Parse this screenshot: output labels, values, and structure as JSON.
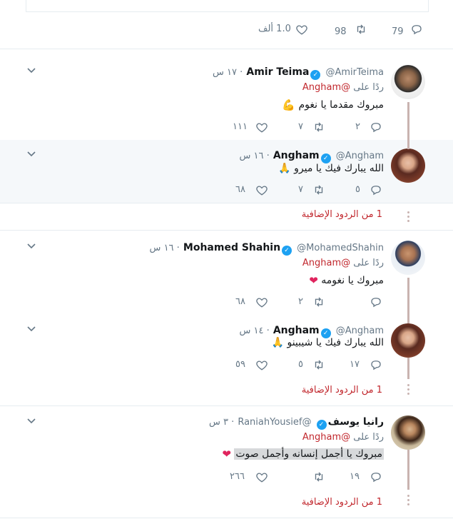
{
  "top_stats": {
    "replies": "79",
    "retweets": "98",
    "likes": "1.0 ألف"
  },
  "tweets": [
    {
      "name": "Amir Teima",
      "handle": "@AmirTeima",
      "time": "١٧ س",
      "reply_prefix": "ردًا على",
      "reply_to": "@Angham",
      "text": "مبروك مقدما يا نغوم",
      "replies": "٢",
      "retweets": "٧",
      "likes": "١١١"
    },
    {
      "name": "Angham",
      "handle": "@Angham",
      "time": "١٦ س",
      "text": "الله يبارك فيك يا ميرو",
      "replies": "٥",
      "retweets": "٧",
      "likes": "٦٨",
      "more": "1 من الردود الإضافية"
    },
    {
      "name": "Mohamed Shahin",
      "handle": "@MohamedShahin",
      "time": "١٦ س",
      "reply_prefix": "ردًا على",
      "reply_to": "@Angham",
      "text": "مبروك يا نغومه",
      "replies": "",
      "retweets": "٢",
      "likes": "٦٨"
    },
    {
      "name": "Angham",
      "handle": "@Angham",
      "time": "١٤ س",
      "text": "الله يبارك فيك يا شيبينو",
      "replies": "١٧",
      "retweets": "٥",
      "likes": "٥٩",
      "more": "1 من الردود الإضافية"
    },
    {
      "name": "رانيا يوسف",
      "handle": "@RaniahYousief",
      "time": "٣ س",
      "reply_prefix": "ردًا على",
      "reply_to": "@Angham",
      "text": "مبروك يا أجمل إنسانه وأجمل صوت",
      "replies": "١٩",
      "retweets": "",
      "likes": "٢٦٦",
      "more": "1 من الردود الإضافية"
    }
  ],
  "colors": {
    "accent": "#c1272d",
    "verified": "#1da1f2",
    "muted": "#657786",
    "thread": "#c9b3b0",
    "highlight_bg": "#f5f8fa"
  },
  "icons": [
    "reply-icon",
    "retweet-icon",
    "like-icon",
    "chevron-down-icon",
    "verified-icon"
  ]
}
